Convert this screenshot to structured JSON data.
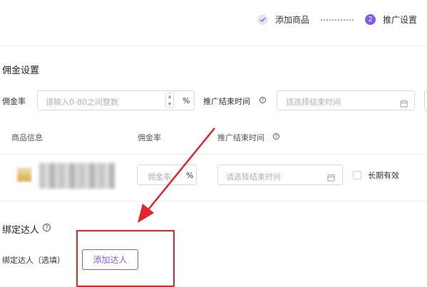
{
  "steps": [
    {
      "label": "添加商品",
      "state": "done"
    },
    {
      "label": "推广设置",
      "number": "2",
      "state": "active"
    }
  ],
  "commission": {
    "title": "佣金设置",
    "rate_label": "佣金率",
    "rate_placeholder": "请输入0-80之间整数",
    "rate_unit": "%",
    "end_time_label": "推广结束时间",
    "end_time_placeholder": "请选择结束时间"
  },
  "table": {
    "headers": [
      "商品信息",
      "佣金率",
      "推广结束时间"
    ],
    "row": {
      "rate_placeholder": "佣金率",
      "rate_unit": "%",
      "end_time_placeholder": "请选择结束时间",
      "long_term_label": "长期有效"
    }
  },
  "bind": {
    "title": "绑定达人",
    "label": "绑定达人（选填）",
    "add_button": "添加达人"
  },
  "colors": {
    "accent": "#7a5cf0",
    "annotation": "#e3242b"
  }
}
